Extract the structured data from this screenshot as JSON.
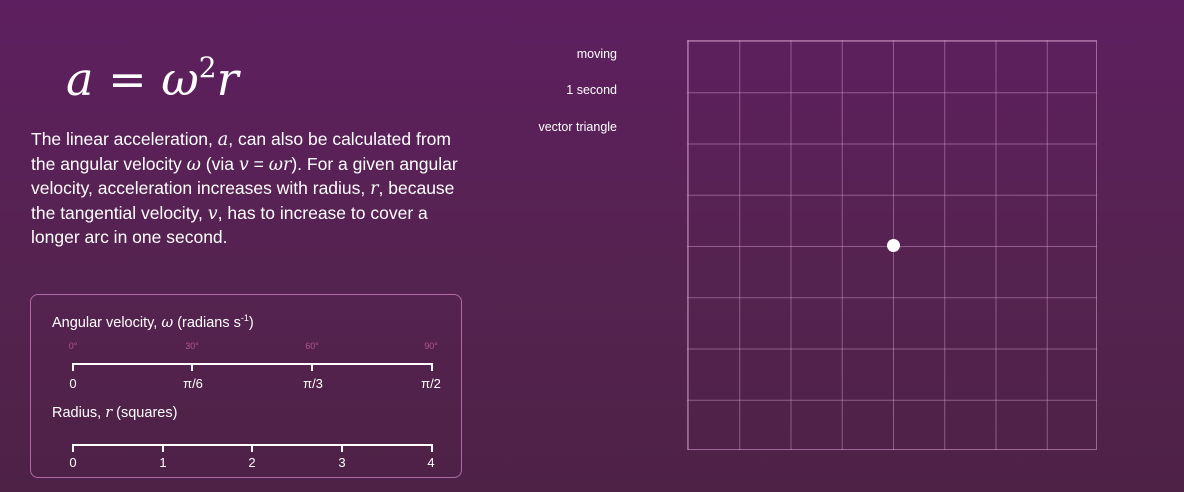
{
  "formula": {
    "lhs": "a",
    "eq": "=",
    "omega": "ω",
    "power": "2",
    "r": "r"
  },
  "description": {
    "p1": "The linear acceleration, ",
    "a": "a",
    "p2": ", can also be calculated from the angular velocity ",
    "omega": "ω",
    "p3": " (via ",
    "v1": "v",
    "p4": " = ",
    "wr": "ωr",
    "p5": ").  For a given angular velocity, acceleration increases with radius, ",
    "r": "r",
    "p6": ", because the tangential velocity, ",
    "v2": "v",
    "p7": ", has to increase to cover a longer arc in one second."
  },
  "angular_velocity": {
    "label_pre": "Angular velocity, ",
    "label_sym": "ω",
    "label_post": " (radians s",
    "label_exp": "-1",
    "label_close": ")",
    "degrees": [
      "0°",
      "30°",
      "60°",
      "90°"
    ],
    "ticks": [
      "0",
      "π/6",
      "π/3",
      "π/2"
    ]
  },
  "radius": {
    "label_pre": "Radius, ",
    "label_sym": "r",
    "label_post": " (squares)",
    "ticks": [
      "0",
      "1",
      "2",
      "3",
      "4"
    ]
  },
  "menu": {
    "moving": "moving",
    "one_second": "1 second",
    "vector_triangle": "vector triangle"
  },
  "colors": {
    "background": "#5a1f58",
    "accent": "#b0578d",
    "grid": "#d8a0d0"
  }
}
